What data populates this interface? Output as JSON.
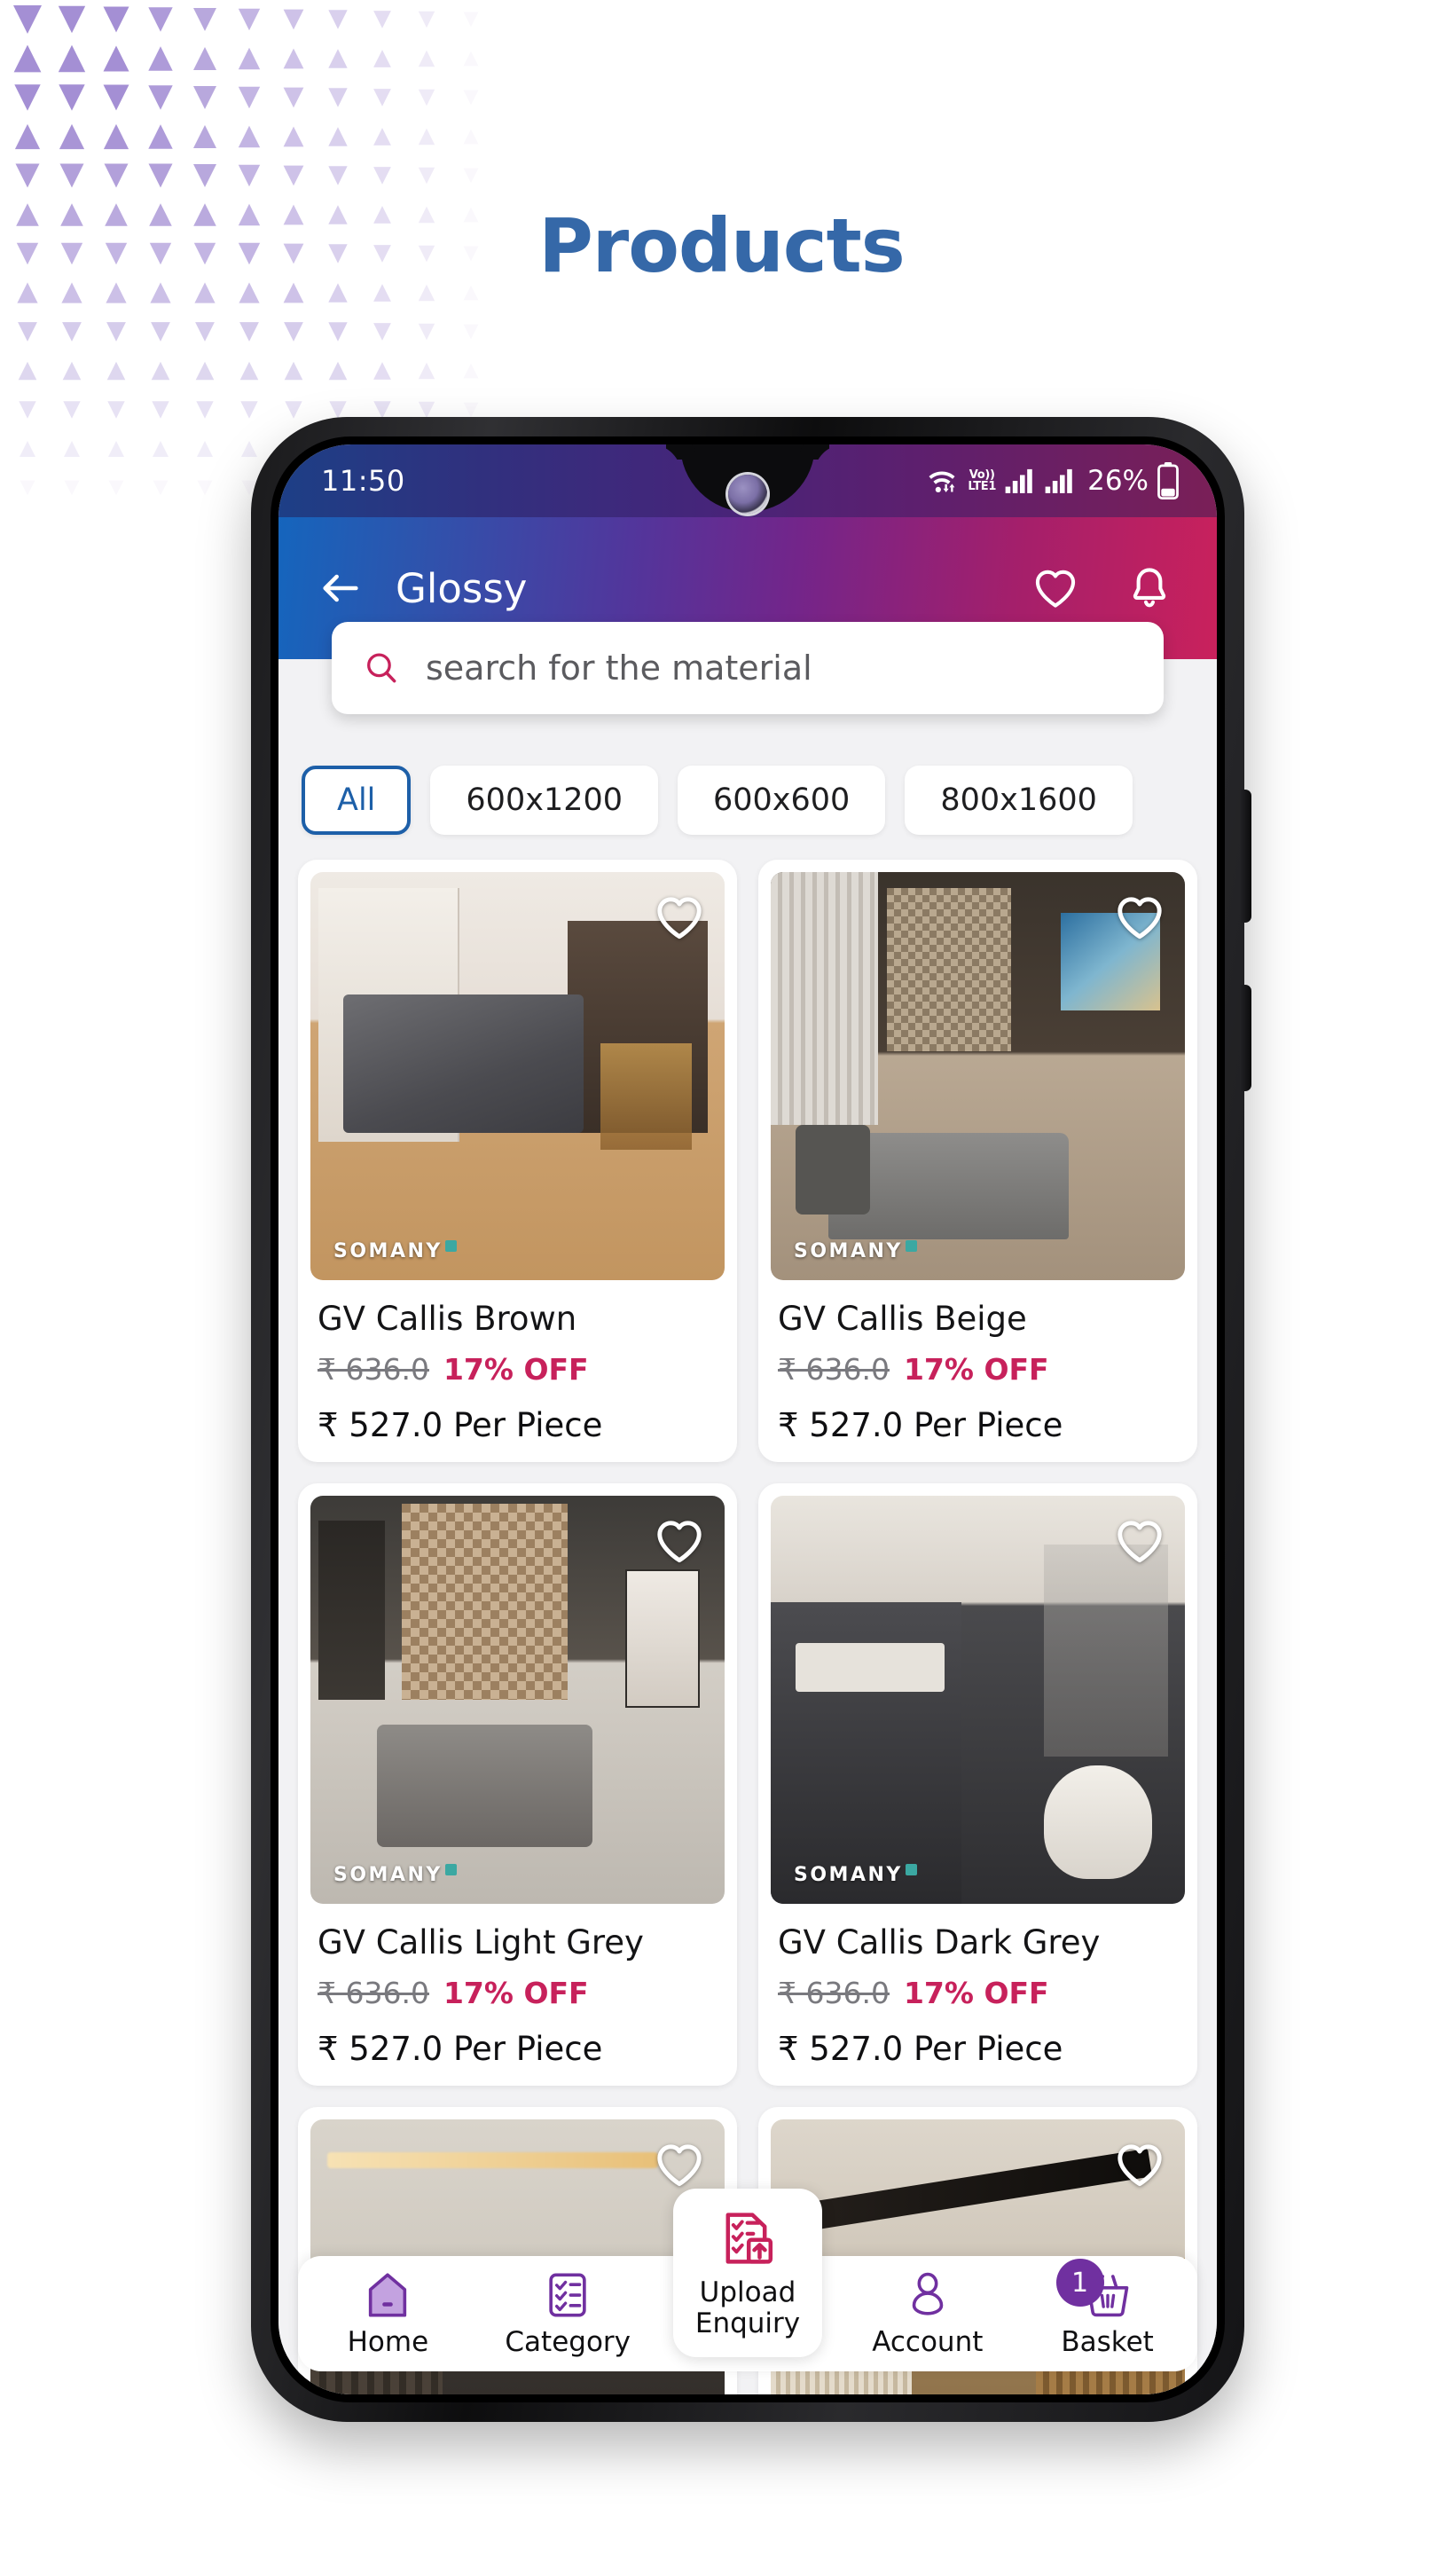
{
  "page": {
    "title": "Products",
    "title_color": "#3568a8",
    "background": "#ffffff",
    "decor": {
      "name": "triangle-pattern",
      "color": "#a48fd4"
    }
  },
  "device": {
    "statusbar": {
      "time": "11:50",
      "volte_top": "Vo))",
      "volte_bottom": "LTE1",
      "battery_percent": "26%",
      "icons": [
        "wifi-icon",
        "volte-icon",
        "signal-bars-icon",
        "signal-bars-icon",
        "battery-icon"
      ]
    }
  },
  "appbar": {
    "back_icon": "back-arrow-icon",
    "title": "Glossy",
    "favorite_icon": "heart-icon",
    "notification_icon": "bell-icon",
    "gradient_from": "#1565bd",
    "gradient_to": "#c9215c"
  },
  "search": {
    "placeholder": "search for the material",
    "value": "",
    "icon": "search-icon",
    "icon_color": "#c7215b"
  },
  "filters": {
    "selected": "All",
    "accent": "#1d5fa8",
    "chips": [
      {
        "label": "All",
        "active": true
      },
      {
        "label": "600x1200",
        "active": false
      },
      {
        "label": "600x600",
        "active": false
      },
      {
        "label": "800x1600",
        "active": false
      }
    ]
  },
  "products": [
    {
      "name": "GV Callis Brown",
      "old_price": "₹ 636.0",
      "discount": "17% OFF",
      "price": "₹ 527.0 Per Piece",
      "watermark": "SOMANY",
      "favorite_icon": "heart-icon",
      "room": "r1"
    },
    {
      "name": "GV Callis Beige",
      "old_price": "₹ 636.0",
      "discount": "17% OFF",
      "price": "₹ 527.0 Per Piece",
      "watermark": "SOMANY",
      "favorite_icon": "heart-icon",
      "room": "r2"
    },
    {
      "name": "GV Callis Light Grey",
      "old_price": "₹ 636.0",
      "discount": "17% OFF",
      "price": "₹ 527.0 Per Piece",
      "watermark": "SOMANY",
      "favorite_icon": "heart-icon",
      "room": "r3"
    },
    {
      "name": "GV Callis Dark Grey",
      "old_price": "₹ 636.0",
      "discount": "17% OFF",
      "price": "₹ 527.0 Per Piece",
      "watermark": "SOMANY",
      "favorite_icon": "heart-icon",
      "room": "r4"
    }
  ],
  "products_partial": [
    {
      "favorite_icon": "heart-icon",
      "room": "r5"
    },
    {
      "favorite_icon": "heart-icon",
      "room": "r6"
    }
  ],
  "bottom_nav": {
    "accent": "#7030a0",
    "upload_accent": "#c7215b",
    "items": [
      {
        "label": "Home",
        "icon": "home-icon"
      },
      {
        "label": "Category",
        "icon": "checklist-icon"
      },
      {
        "label": "Account",
        "icon": "person-icon"
      },
      {
        "label": "Basket",
        "icon": "basket-icon",
        "badge": "1"
      }
    ],
    "upload": {
      "label_line1": "Upload",
      "label_line2": "Enquiry",
      "icon": "upload-document-icon"
    }
  }
}
